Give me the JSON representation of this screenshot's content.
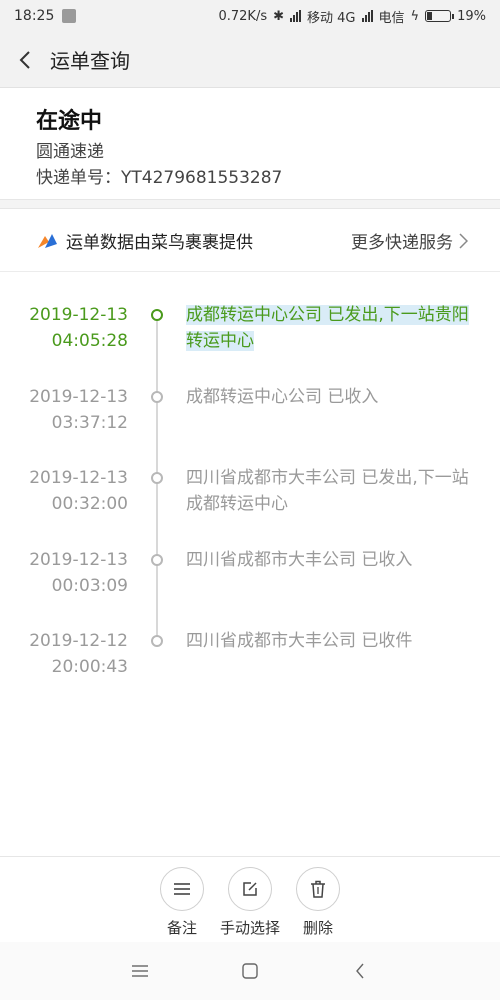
{
  "status_bar": {
    "time": "18:25",
    "net_speed": "0.72K/s",
    "carrier1": "移动 4G",
    "carrier2": "电信",
    "battery": "19%"
  },
  "header": {
    "title": "运单查询"
  },
  "summary": {
    "status": "在途中",
    "carrier": "圆通速递",
    "tracking": "快递单号：YT4279681553287"
  },
  "provider": {
    "text": "运单数据由菜鸟裹裹提供",
    "more": "更多快递服务"
  },
  "events": [
    {
      "date": "2019-12-13",
      "time": "04:05:28",
      "desc": "成都转运中心公司 已发出,下一站贵阳转运中心"
    },
    {
      "date": "2019-12-13",
      "time": "03:37:12",
      "desc": "成都转运中心公司 已收入"
    },
    {
      "date": "2019-12-13",
      "time": "00:32:00",
      "desc": "四川省成都市大丰公司 已发出,下一站 成都转运中心"
    },
    {
      "date": "2019-12-13",
      "time": "00:03:09",
      "desc": "四川省成都市大丰公司 已收入"
    },
    {
      "date": "2019-12-12",
      "time": "20:00:43",
      "desc": "四川省成都市大丰公司 已收件"
    }
  ],
  "actions": {
    "note": "备注",
    "manual": "手动选择",
    "delete": "删除"
  },
  "colors": {
    "accent": "#4a9a1c",
    "muted": "#9a9a9a",
    "highlight": "#d9ecf7"
  }
}
